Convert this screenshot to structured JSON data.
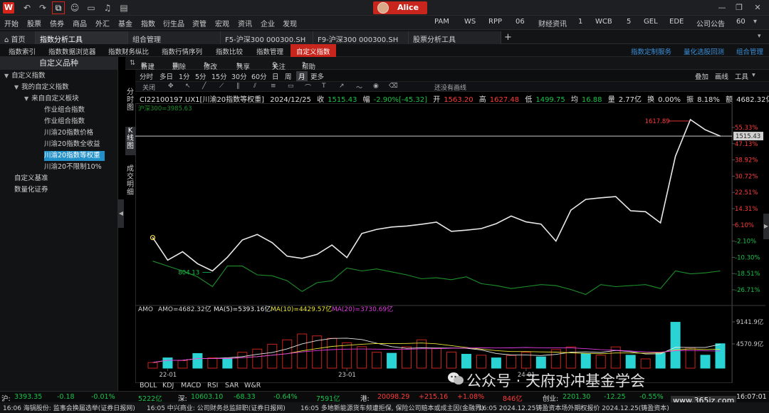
{
  "titlebar": {
    "logo": "W",
    "icons": [
      "undo-icon",
      "redo-icon",
      "crop-icon",
      "chat-icon",
      "monitor-icon",
      "bell-icon",
      "book-icon"
    ],
    "user_name": "Alice",
    "window_controls": [
      "minimize-icon",
      "restore-icon",
      "close-icon"
    ]
  },
  "menu": {
    "left": [
      "开始",
      "股票",
      "债券",
      "商品",
      "外汇",
      "基金",
      "指数",
      "衍生品",
      "资管",
      "宏观",
      "资讯",
      "企业",
      "发现"
    ],
    "right": [
      "PAM",
      "WS",
      "RPP",
      "06",
      "财经资讯",
      "1",
      "WCB",
      "5",
      "GEL",
      "EDE",
      "公司公告",
      "60"
    ]
  },
  "tabs": {
    "items": [
      "首页",
      "指数分析工具",
      "组合管理",
      "F5-沪深300 000300.SH",
      "F9-沪深300 000300.SH",
      "股票分析工具"
    ],
    "active": "指数分析工具"
  },
  "subtabs": {
    "items": [
      "指数索引",
      "指数数据浏览器",
      "指数财务纵比",
      "指数行情序列",
      "指数比较",
      "指数管理",
      "自定义指数"
    ],
    "active": "自定义指数",
    "right": [
      "指数定制服务",
      "量化选股回测",
      "组合管理"
    ]
  },
  "sidebar": {
    "title": "自定义品种",
    "tree": [
      {
        "label": "自定义指数",
        "level": 0,
        "arrow": "▼"
      },
      {
        "label": "我的自定义指数",
        "level": 1,
        "arrow": "▼"
      },
      {
        "label": "来自自定义板块",
        "level": 2,
        "arrow": "▼"
      },
      {
        "label": "作业组合指数",
        "level": 3
      },
      {
        "label": "作业组合指数",
        "level": 3
      },
      {
        "label": "川渝20指数价格",
        "level": 3
      },
      {
        "label": "川渝20指数全收益",
        "level": 3
      },
      {
        "label": "川渝20指数等权重",
        "level": 3,
        "selected": true
      },
      {
        "label": "川渝20不限制10%",
        "level": 3
      },
      {
        "label": "自定义基准",
        "level": 0
      },
      {
        "label": "数量化证券",
        "level": 0
      }
    ]
  },
  "toolbar": {
    "new": "新建",
    "delete": "删除",
    "modify": "修改",
    "share": "共享",
    "follow": "关注",
    "help": "帮助"
  },
  "periods": [
    "分时",
    "多日",
    "1分",
    "5分",
    "15分",
    "30分",
    "60分",
    "日",
    "周",
    "月",
    "更多"
  ],
  "active_period": "月",
  "right_tools": [
    "叠加",
    "画线",
    "工具"
  ],
  "drawbar": {
    "close": "关闭",
    "no_lines": "还没有画线"
  },
  "vtabs": [
    "分时图",
    "K线图",
    "成交明细"
  ],
  "quote": {
    "code": "CI22100197.UX1[川渝20指数等权重]",
    "date": "2024/12/25",
    "close_label": "收",
    "close": "1515.43",
    "chg_label": "幅",
    "chg": "-2.90%[-45.32]",
    "open_label": "开",
    "open": "1563.20",
    "high_label": "高",
    "high": "1627.48",
    "low_label": "低",
    "low": "1499.75",
    "avg_label": "均",
    "avg": "16.88",
    "vol_label": "量",
    "vol": "2.77亿",
    "turn_label": "换",
    "turn": "0.00%",
    "amp_label": "振",
    "amp": "8.18%",
    "amt_label": "额",
    "amt": "4682.32亿"
  },
  "overlay_label": "沪深300=3985.63",
  "amo": {
    "label": "AMO",
    "amo": "AMO=4682.32亿",
    "ma5": "MA(5)=5393.16亿",
    "ma10": "MA(10)=4429.57亿",
    "ma20": "MA(20)=3730.69亿"
  },
  "indicator_tabs": [
    "BOLL",
    "KDJ",
    "MACD",
    "RSI",
    "SAR",
    "W&R"
  ],
  "colors": {
    "up": "#ff3b3b",
    "down": "#19c24a",
    "price": "#e8e8e8",
    "overlay": "#1d8f2a",
    "bar_up": "#c8251c",
    "bar_down": "#2ad4d4",
    "ma5": "#e8e8e8",
    "ma10": "#e8e335",
    "ma20": "#e03ae0"
  },
  "chart_data": {
    "type": "line",
    "series": [
      {
        "values": [
          0.0,
          -11.5,
          -7.2,
          -13.3,
          -17.0,
          -10.0,
          -1.2,
          1.6,
          -2.6,
          -9.5,
          -10.6,
          -8.6,
          -3.8,
          -10.2,
          2.1,
          4.2,
          5.4,
          5.9,
          6.8,
          7.9,
          3.2,
          3.8,
          4.6,
          7.1,
          11.0,
          8.0,
          6.9,
          -1.8,
          14.0,
          19.5,
          20.3,
          20.9,
          13.7,
          13.2,
          7.5,
          41.5,
          60.2,
          55.0,
          51.8
        ]
      },
      {
        "values": [
          -12.0,
          -14.5,
          -17.0,
          -20.0,
          -25.0,
          -14.5,
          -14.5,
          -19.0,
          -19.5,
          -22.0,
          -27.5,
          -23.0,
          -22.0,
          -15.5,
          -17.0,
          -16.0,
          -17.5,
          -19.0,
          -21.0,
          -20.5,
          -21.5,
          -20.0,
          -23.5,
          -24.5,
          -26.0,
          -25.0,
          -24.0,
          -24.5,
          -26.5,
          -29.0,
          -24.0,
          -25.0,
          -24.5,
          -24.0,
          -26.0,
          -17.0,
          -18.5,
          -18.0,
          -17.0
        ]
      }
    ],
    "ylim": [
      -31.0,
      62.0
    ],
    "yticks": [
      "55.33%",
      "47.13%",
      "38.92%",
      "30.72%",
      "22.51%",
      "14.31%",
      "6.10%",
      "-2.10%",
      "-10.30%",
      "-18.51%",
      "-26.71%"
    ],
    "annotations": {
      "max": "1617.89",
      "min": "804.13",
      "current": "1515.43"
    },
    "volume": {
      "values": [
        1150,
        2100,
        1550,
        3000,
        2100,
        1900,
        3250,
        3900,
        4900,
        5800,
        7000,
        6600,
        6100,
        5200,
        4400,
        3250,
        3050,
        4350,
        5800,
        4100,
        3300,
        2850,
        2650,
        2100,
        2600,
        3250,
        2300,
        3800,
        4350,
        2950,
        2650,
        4350,
        2650,
        1900,
        3100,
        9400,
        4200,
        2650,
        5000
      ],
      "colors": [
        "up",
        "down",
        "up",
        "down",
        "up",
        "down",
        "up",
        "up",
        "up",
        "up",
        "up",
        "up",
        "up",
        "up",
        "up",
        "up",
        "down",
        "up",
        "up",
        "up",
        "up",
        "down",
        "up",
        "down",
        "up",
        "up",
        "down",
        "up",
        "up",
        "down",
        "up",
        "up",
        "down",
        "up",
        "down",
        "down",
        "up",
        "down",
        "down"
      ],
      "ylim": [
        0,
        10500
      ],
      "yticks": [
        "9141.9亿",
        "4570.9亿"
      ]
    },
    "xticks": [
      "22-01",
      "23-01",
      "24-01"
    ]
  },
  "status": {
    "sh_label": "沪:",
    "sh": "3393.35",
    "sh_chg": "-0.18",
    "sh_pct": "-0.01%",
    "sh_amt": "5222亿",
    "sz_label": "深:",
    "sz": "10603.10",
    "sz_chg": "-68.33",
    "sz_pct": "-0.64%",
    "sz_amt": "7591亿",
    "hk_label": "港:",
    "hk": "20098.29",
    "hk_chg": "+215.16",
    "hk_pct": "+1.08%",
    "hk_amt": "846亿",
    "cy_label": "创业:",
    "cy": "2201.30",
    "cy_chg": "-12.25",
    "cy_pct": "-0.55%",
    "time": "16:07:01"
  },
  "news": [
    "16:06  海锅股份: 监事会换届选举(证券日报网)",
    "16:05  中兴商业: 公司财务总监辞职(证券日报网)",
    "16:05  多地新能源货车频遭拒保, 保险公司赔本或成主因(金融界)",
    "16:05  2024.12.25铸盈资本场外期权报价 2024.12.25(铸盈资本)"
  ],
  "watermark": {
    "text": "公众号 · 天府对冲基金学会",
    "site": "www.365jz.com"
  }
}
